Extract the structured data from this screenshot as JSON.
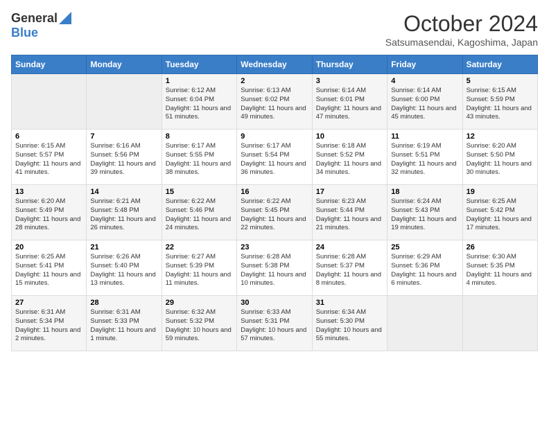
{
  "logo": {
    "general": "General",
    "blue": "Blue"
  },
  "title": "October 2024",
  "location": "Satsumasendai, Kagoshima, Japan",
  "days_of_week": [
    "Sunday",
    "Monday",
    "Tuesday",
    "Wednesday",
    "Thursday",
    "Friday",
    "Saturday"
  ],
  "weeks": [
    [
      {
        "day": "",
        "info": ""
      },
      {
        "day": "",
        "info": ""
      },
      {
        "day": "1",
        "info": "Sunrise: 6:12 AM\nSunset: 6:04 PM\nDaylight: 11 hours and 51 minutes."
      },
      {
        "day": "2",
        "info": "Sunrise: 6:13 AM\nSunset: 6:02 PM\nDaylight: 11 hours and 49 minutes."
      },
      {
        "day": "3",
        "info": "Sunrise: 6:14 AM\nSunset: 6:01 PM\nDaylight: 11 hours and 47 minutes."
      },
      {
        "day": "4",
        "info": "Sunrise: 6:14 AM\nSunset: 6:00 PM\nDaylight: 11 hours and 45 minutes."
      },
      {
        "day": "5",
        "info": "Sunrise: 6:15 AM\nSunset: 5:59 PM\nDaylight: 11 hours and 43 minutes."
      }
    ],
    [
      {
        "day": "6",
        "info": "Sunrise: 6:15 AM\nSunset: 5:57 PM\nDaylight: 11 hours and 41 minutes."
      },
      {
        "day": "7",
        "info": "Sunrise: 6:16 AM\nSunset: 5:56 PM\nDaylight: 11 hours and 39 minutes."
      },
      {
        "day": "8",
        "info": "Sunrise: 6:17 AM\nSunset: 5:55 PM\nDaylight: 11 hours and 38 minutes."
      },
      {
        "day": "9",
        "info": "Sunrise: 6:17 AM\nSunset: 5:54 PM\nDaylight: 11 hours and 36 minutes."
      },
      {
        "day": "10",
        "info": "Sunrise: 6:18 AM\nSunset: 5:52 PM\nDaylight: 11 hours and 34 minutes."
      },
      {
        "day": "11",
        "info": "Sunrise: 6:19 AM\nSunset: 5:51 PM\nDaylight: 11 hours and 32 minutes."
      },
      {
        "day": "12",
        "info": "Sunrise: 6:20 AM\nSunset: 5:50 PM\nDaylight: 11 hours and 30 minutes."
      }
    ],
    [
      {
        "day": "13",
        "info": "Sunrise: 6:20 AM\nSunset: 5:49 PM\nDaylight: 11 hours and 28 minutes."
      },
      {
        "day": "14",
        "info": "Sunrise: 6:21 AM\nSunset: 5:48 PM\nDaylight: 11 hours and 26 minutes."
      },
      {
        "day": "15",
        "info": "Sunrise: 6:22 AM\nSunset: 5:46 PM\nDaylight: 11 hours and 24 minutes."
      },
      {
        "day": "16",
        "info": "Sunrise: 6:22 AM\nSunset: 5:45 PM\nDaylight: 11 hours and 22 minutes."
      },
      {
        "day": "17",
        "info": "Sunrise: 6:23 AM\nSunset: 5:44 PM\nDaylight: 11 hours and 21 minutes."
      },
      {
        "day": "18",
        "info": "Sunrise: 6:24 AM\nSunset: 5:43 PM\nDaylight: 11 hours and 19 minutes."
      },
      {
        "day": "19",
        "info": "Sunrise: 6:25 AM\nSunset: 5:42 PM\nDaylight: 11 hours and 17 minutes."
      }
    ],
    [
      {
        "day": "20",
        "info": "Sunrise: 6:25 AM\nSunset: 5:41 PM\nDaylight: 11 hours and 15 minutes."
      },
      {
        "day": "21",
        "info": "Sunrise: 6:26 AM\nSunset: 5:40 PM\nDaylight: 11 hours and 13 minutes."
      },
      {
        "day": "22",
        "info": "Sunrise: 6:27 AM\nSunset: 5:39 PM\nDaylight: 11 hours and 11 minutes."
      },
      {
        "day": "23",
        "info": "Sunrise: 6:28 AM\nSunset: 5:38 PM\nDaylight: 11 hours and 10 minutes."
      },
      {
        "day": "24",
        "info": "Sunrise: 6:28 AM\nSunset: 5:37 PM\nDaylight: 11 hours and 8 minutes."
      },
      {
        "day": "25",
        "info": "Sunrise: 6:29 AM\nSunset: 5:36 PM\nDaylight: 11 hours and 6 minutes."
      },
      {
        "day": "26",
        "info": "Sunrise: 6:30 AM\nSunset: 5:35 PM\nDaylight: 11 hours and 4 minutes."
      }
    ],
    [
      {
        "day": "27",
        "info": "Sunrise: 6:31 AM\nSunset: 5:34 PM\nDaylight: 11 hours and 2 minutes."
      },
      {
        "day": "28",
        "info": "Sunrise: 6:31 AM\nSunset: 5:33 PM\nDaylight: 11 hours and 1 minute."
      },
      {
        "day": "29",
        "info": "Sunrise: 6:32 AM\nSunset: 5:32 PM\nDaylight: 10 hours and 59 minutes."
      },
      {
        "day": "30",
        "info": "Sunrise: 6:33 AM\nSunset: 5:31 PM\nDaylight: 10 hours and 57 minutes."
      },
      {
        "day": "31",
        "info": "Sunrise: 6:34 AM\nSunset: 5:30 PM\nDaylight: 10 hours and 55 minutes."
      },
      {
        "day": "",
        "info": ""
      },
      {
        "day": "",
        "info": ""
      }
    ]
  ]
}
